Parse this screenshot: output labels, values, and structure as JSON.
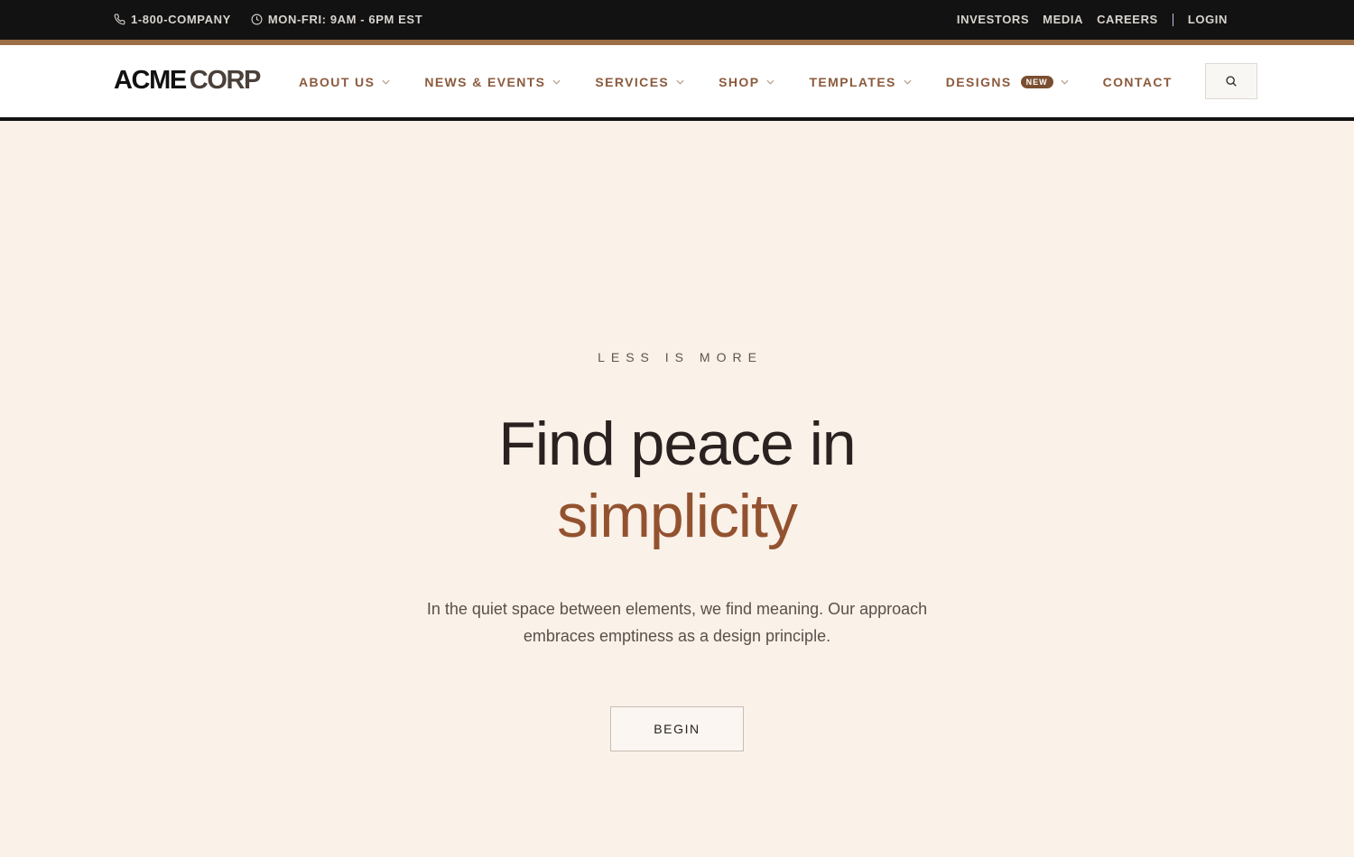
{
  "topbar": {
    "phone": "1-800-COMPANY",
    "hours": "MON-FRI: 9AM - 6PM EST",
    "links": [
      "INVESTORS",
      "MEDIA",
      "CAREERS"
    ],
    "login": "LOGIN"
  },
  "logo": {
    "part1": "ACME",
    "part2": "CORP"
  },
  "nav": {
    "items": [
      {
        "label": "ABOUT US",
        "dropdown": true
      },
      {
        "label": "NEWS & EVENTS",
        "dropdown": true
      },
      {
        "label": "SERVICES",
        "dropdown": true
      },
      {
        "label": "SHOP",
        "dropdown": true
      },
      {
        "label": "TEMPLATES",
        "dropdown": true
      },
      {
        "label": "DESIGNS",
        "dropdown": true,
        "badge": "NEW"
      },
      {
        "label": "CONTACT",
        "dropdown": false
      }
    ],
    "search_icon": "search-icon"
  },
  "hero": {
    "eyebrow": "LESS IS MORE",
    "headline_line1": "Find peace in",
    "headline_line2": "simplicity",
    "subtext": "In the quiet space between elements, we find meaning. Our approach embraces emptiness as a design principle.",
    "cta": "BEGIN"
  },
  "colors": {
    "accent": "#93522f",
    "nav_text": "#8b5a3c",
    "topbar_bg": "#121212",
    "hero_bg": "#faf1e8",
    "strip": "#9c6f47"
  }
}
